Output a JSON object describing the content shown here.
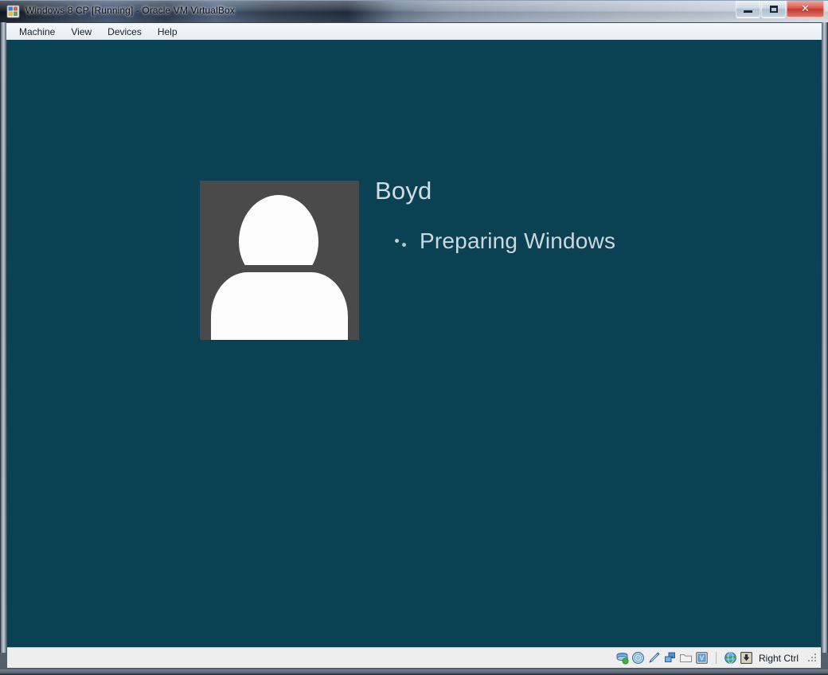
{
  "window": {
    "title": "Windows 8 CP [Running] - Oracle VM VirtualBox",
    "app_icon": "virtualbox-icon",
    "controls": {
      "minimize": "Minimize",
      "maximize": "Maximize",
      "close": "Close",
      "close_glyph": "✕"
    }
  },
  "menubar": {
    "items": [
      {
        "label": "Machine"
      },
      {
        "label": "View"
      },
      {
        "label": "Devices"
      },
      {
        "label": "Help"
      }
    ]
  },
  "guest": {
    "background_color": "#0b4253",
    "avatar": {
      "tile_color": "#4a4a4a",
      "silhouette_color": "#fdfdfd",
      "icon": "default-user-avatar"
    },
    "user_name": "Boyd",
    "status_text": "Preparing Windows",
    "spinner": "loading-spinner",
    "text_color": "#ccd8dd"
  },
  "statusbar": {
    "device_icons": [
      {
        "name": "hard-disk-icon",
        "title": "Hard Disks"
      },
      {
        "name": "optical-drive-icon",
        "title": "CD/DVD Devices"
      },
      {
        "name": "floppy-drive-icon",
        "title": "Floppy Devices"
      },
      {
        "name": "network-adapters-icon",
        "title": "Network Adapters"
      },
      {
        "name": "shared-folders-icon",
        "title": "Shared Folders"
      },
      {
        "name": "video-capture-icon",
        "title": "Video Capture"
      }
    ],
    "right_icons": [
      {
        "name": "remote-display-icon",
        "title": "Remote Desktop"
      },
      {
        "name": "host-key-icon",
        "title": "Host Key"
      }
    ],
    "host_key_label": "Right Ctrl",
    "resize_grip": "resize-grip"
  }
}
